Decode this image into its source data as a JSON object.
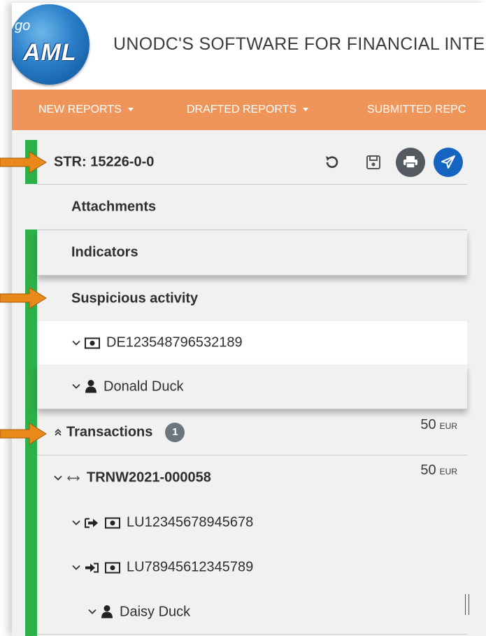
{
  "app": {
    "logo_go": "go",
    "logo_aml": "AML",
    "title": "UNODC'S SOFTWARE FOR FINANCIAL INTE"
  },
  "nav": {
    "items": [
      {
        "label": "NEW REPORTS",
        "has_caret": true
      },
      {
        "label": "DRAFTED REPORTS",
        "has_caret": true
      },
      {
        "label": "SUBMITTED REPC",
        "has_caret": false
      }
    ]
  },
  "report": {
    "title": "STR: 15226-0-0",
    "toolbar_icons": [
      "undo-icon",
      "save-icon",
      "print-icon",
      "send-icon"
    ]
  },
  "sections": {
    "attachments": "Attachments",
    "indicators": "Indicators",
    "suspicious_activity": "Suspicious activity",
    "account": "DE123548796532189",
    "person": "Donald Duck",
    "transactions": "Transactions",
    "transactions_count": "1",
    "transactions_amount": "50",
    "transactions_currency": "EUR"
  },
  "transaction": {
    "id": "TRNW2021-000058",
    "amount": "50",
    "currency": "EUR",
    "from_account": "LU12345678945678",
    "to_account": "LU78945612345789",
    "person": "Daisy Duck"
  },
  "colors": {
    "nav": "#f0955a",
    "green": "#2db04a",
    "arrow": "#e8891a",
    "send": "#1565c0",
    "print": "#555a60"
  }
}
